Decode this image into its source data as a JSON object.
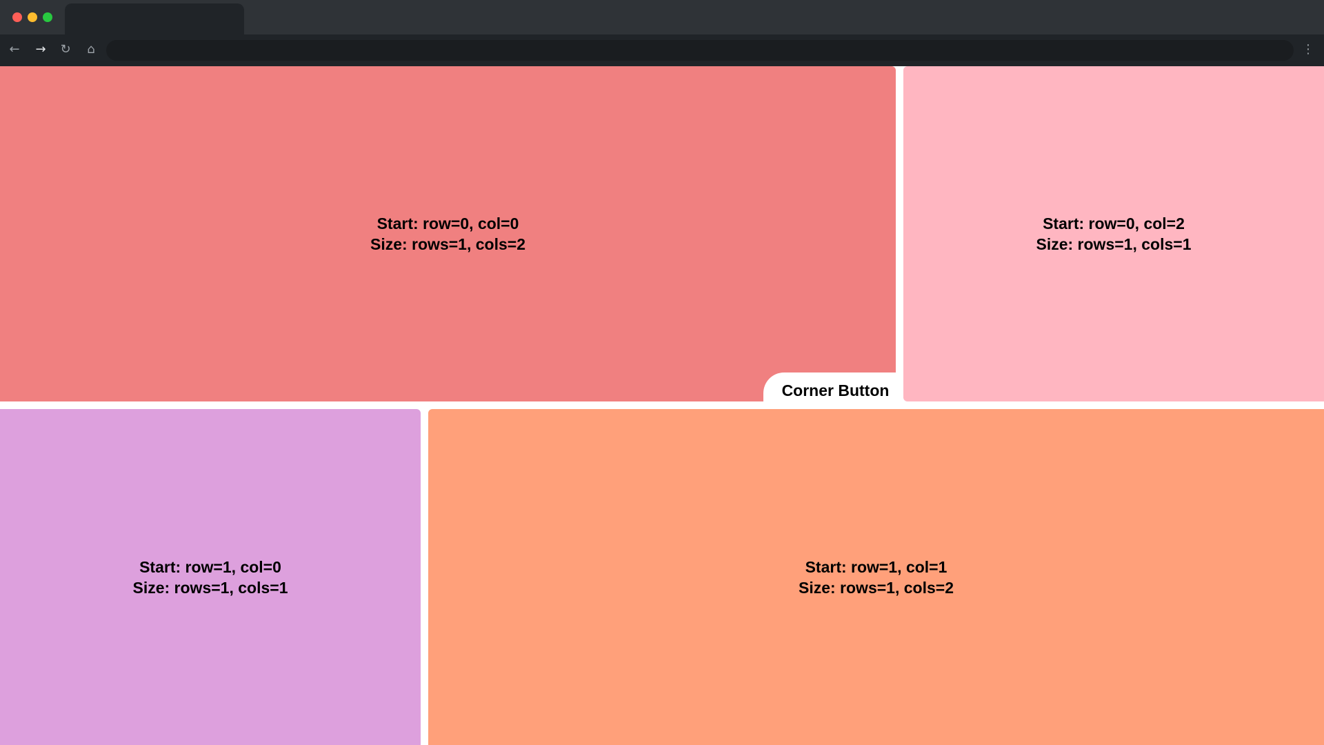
{
  "browser": {
    "window_controls": [
      {
        "name": "close",
        "color": "#ff5f57"
      },
      {
        "name": "minimize",
        "color": "#febc2e"
      },
      {
        "name": "maximize",
        "color": "#28c840"
      }
    ],
    "tab_title": "",
    "address_bar_value": "",
    "icons": {
      "back": "←",
      "forward": "→",
      "reload": "↻",
      "home": "⌂",
      "menu": "⋮"
    }
  },
  "grid": {
    "cells": [
      {
        "line1": "Start: row=0, col=0",
        "line2": "Size: rows=1, cols=2",
        "color": "#f08080"
      },
      {
        "line1": "Start: row=0, col=2",
        "line2": "Size: rows=1, cols=1",
        "color": "#ffb6c1"
      },
      {
        "line1": "Start: row=1, col=0",
        "line2": "Size: rows=1, cols=1",
        "color": "#dda0dd"
      },
      {
        "line1": "Start: row=1, col=1",
        "line2": "Size: rows=1, cols=2",
        "color": "#ffa07a"
      }
    ],
    "corner_button_label": "Corner Button"
  }
}
